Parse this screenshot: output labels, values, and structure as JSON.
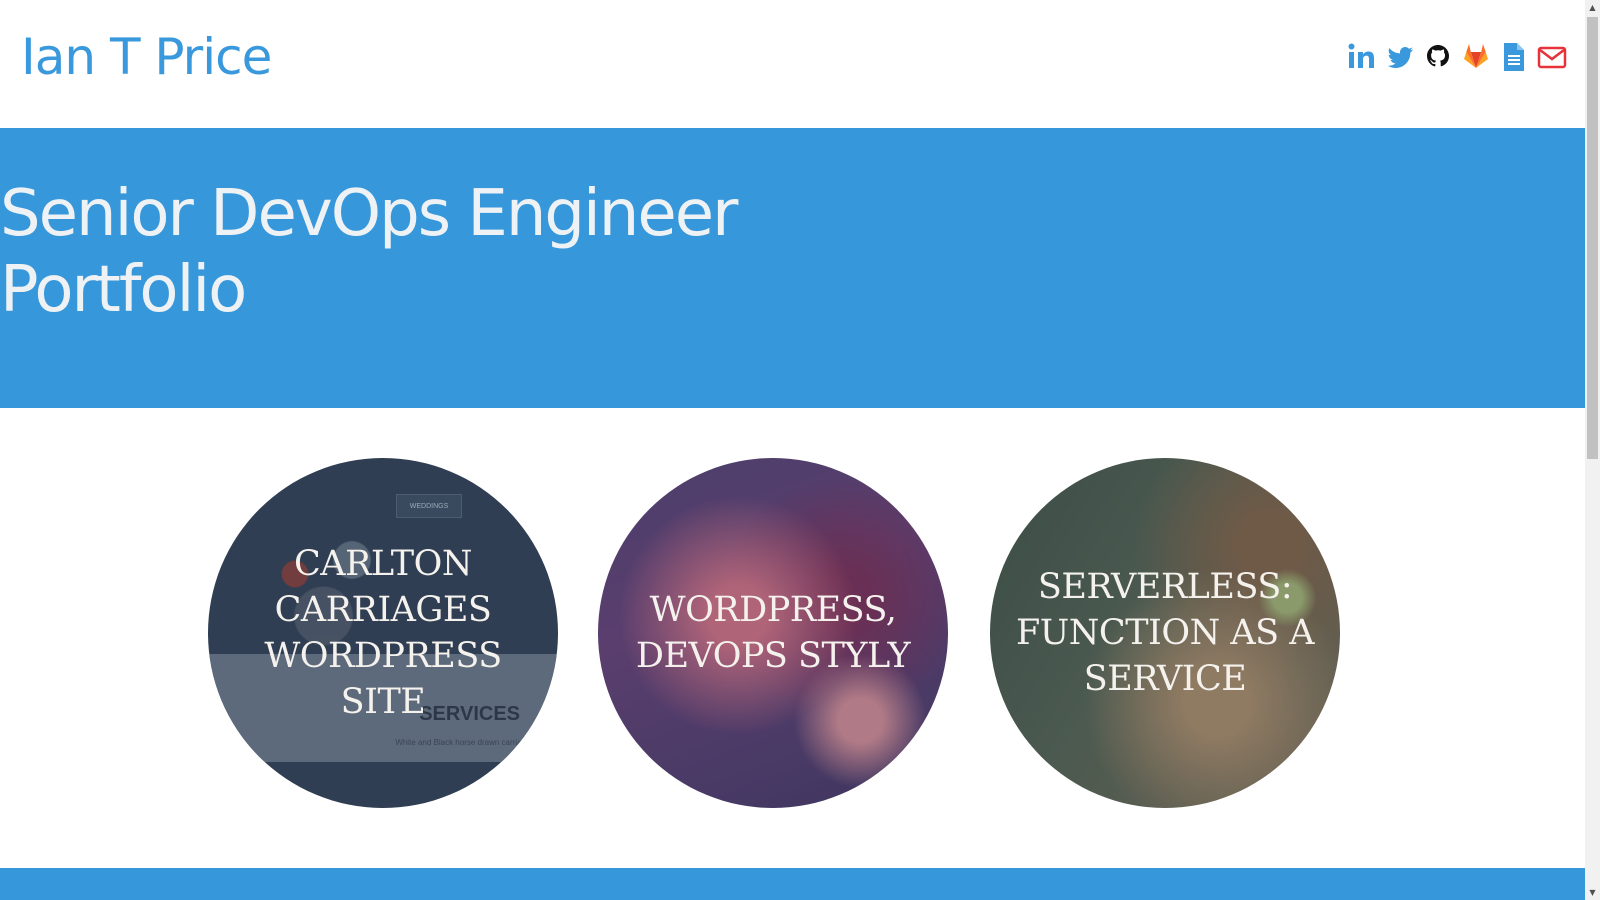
{
  "header": {
    "site_title": "Ian T Price",
    "social": [
      {
        "name": "linkedin-icon",
        "color": "#3a98dc"
      },
      {
        "name": "twitter-icon",
        "color": "#3a98dc"
      },
      {
        "name": "github-icon",
        "color": "#111111"
      },
      {
        "name": "gitlab-icon",
        "color": "#fc6d26"
      },
      {
        "name": "document-icon",
        "color": "#3a98dc"
      },
      {
        "name": "envelope-icon",
        "color": "#e8323a"
      }
    ]
  },
  "hero": {
    "title_line_1": "Senior DevOps Engineer",
    "title_line_2": "Portfolio"
  },
  "portfolio": {
    "items": [
      {
        "label": "Carlton Carriages Wordpress Site",
        "thumb_services": "SERVICES",
        "thumb_small": "White and Black horse drawn carriages for",
        "thumb_nav": "WEDDINGS"
      },
      {
        "label": "WordPress, DevOps Styly"
      },
      {
        "label": "Serverless: Function as a Service"
      }
    ]
  },
  "colors": {
    "brand_blue": "#3797db",
    "title_blue": "#3a98dc"
  }
}
